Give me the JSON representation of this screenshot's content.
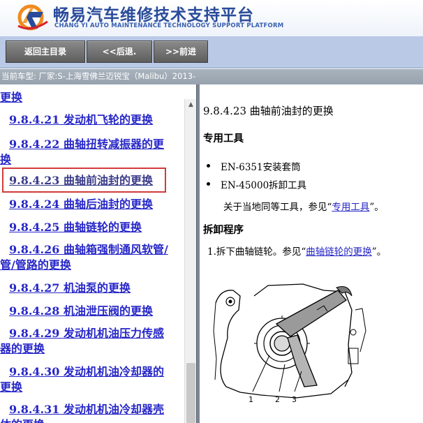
{
  "header": {
    "title": "畅易汽车维修技术支持平台",
    "subtitle": "CHANG YI AUTO MAINTENANCE TECHNOLOGY SUPPORT PLATFORM"
  },
  "toolbar": {
    "home_label": "返回主目录",
    "back_label": "<<后退.",
    "forward_label": ">>前进"
  },
  "model_bar": {
    "text": "当前车型:  厂家:S-上海雪佛兰迈锐宝（Malibu）2013-"
  },
  "nav": {
    "items": [
      {
        "label": "更换"
      },
      {
        "label": "9.8.4.21 发动机飞轮的更换"
      },
      {
        "label": "9.8.4.22 曲轴扭转减振器的更"
      },
      {
        "label": "换"
      },
      {
        "label": "9.8.4.23 曲轴前油封的更换"
      },
      {
        "label": "9.8.4.24 曲轴后油封的更换"
      },
      {
        "label": "9.8.4.25 曲轴链轮的更换"
      },
      {
        "label": "9.8.4.26 曲轴箱强制通风软管/"
      },
      {
        "label": "管/管路的更换"
      },
      {
        "label": "9.8.4.27 机油泵的更换"
      },
      {
        "label": "9.8.4.28 机油泄压阀的更换"
      },
      {
        "label": "9.8.4.29 发动机机油压力传感"
      },
      {
        "label": "器的更换"
      },
      {
        "label": "9.8.4.30 发动机机油冷却器的"
      },
      {
        "label": "更换"
      },
      {
        "label": "9.8.4.31 发动机机油冷却器壳"
      },
      {
        "label": "体的更换"
      }
    ]
  },
  "content": {
    "title": "9.8.4.23 曲轴前油封的更换",
    "tools_heading": "专用工具",
    "tools": [
      "EN-6351安装套筒",
      "EN-45000拆卸工具"
    ],
    "tools_note_prefix": "关于当地同等工具，参见“",
    "tools_note_link": "专用工具",
    "tools_note_suffix": "”。",
    "removal_heading": "拆卸程序",
    "step1_prefix": "1.拆下曲轴链轮。参见“",
    "step1_link": "曲轴链轮的更换",
    "step1_suffix": "”。",
    "figure_labels": [
      "1",
      "2",
      "3"
    ]
  },
  "colors": {
    "brand": "#2a4b9a",
    "link": "#2727c8",
    "toolbar_bg": "#b9c9e6",
    "selection_border": "#d23a3a"
  }
}
